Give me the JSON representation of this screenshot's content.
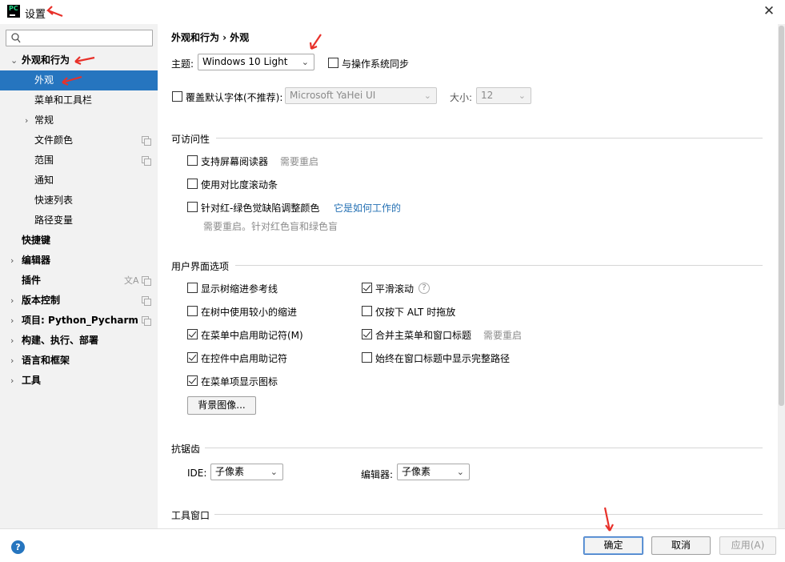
{
  "window": {
    "app_icon_text": "PC",
    "title": "设置",
    "close": "✕"
  },
  "sidebar": {
    "search_placeholder": "",
    "items": [
      {
        "label": "外观和行为",
        "expanded": true,
        "arrow": "⌄"
      },
      {
        "label": "外观",
        "selected": true
      },
      {
        "label": "菜单和工具栏"
      },
      {
        "label": "常规",
        "arrow": "›"
      },
      {
        "label": "文件颜色"
      },
      {
        "label": "范围"
      },
      {
        "label": "通知"
      },
      {
        "label": "快速列表"
      },
      {
        "label": "路径变量"
      },
      {
        "label": "快捷键"
      },
      {
        "label": "编辑器",
        "arrow": "›"
      },
      {
        "label": "插件",
        "lang_icon": "文A"
      },
      {
        "label": "版本控制",
        "arrow": "›"
      },
      {
        "label": "项目: Python_Pycharm",
        "arrow": "›"
      },
      {
        "label": "构建、执行、部署",
        "arrow": "›"
      },
      {
        "label": "语言和框架",
        "arrow": "›"
      },
      {
        "label": "工具",
        "arrow": "›"
      }
    ]
  },
  "main": {
    "breadcrumb": "外观和行为  ›  外观",
    "theme_label": "主题:",
    "theme_value": "Windows 10 Light",
    "sync_os_label": "与操作系统同步",
    "override_font_label": "覆盖默认字体(不推荐):",
    "font_value": "Microsoft YaHei UI",
    "size_label": "大小:",
    "size_value": "12",
    "accessibility": {
      "title": "可访问性",
      "screen_reader": "支持屏幕阅读器",
      "screen_reader_note": "需要重启",
      "contrast_scrollbars": "使用对比度滚动条",
      "color_deficiency": "针对红-绿色觉缺陷调整颜色",
      "how_it_works": "它是如何工作的",
      "color_note": "需要重启。针对红色盲和绿色盲"
    },
    "ui_options": {
      "title": "用户界面选项",
      "tree_indent_guides": "显示树缩进参考线",
      "smaller_indents": "在树中使用较小的缩进",
      "mnemonics_menu": "在菜单中启用助记符(M)",
      "mnemonics_controls": "在控件中启用助记符",
      "menu_icons": "在菜单项显示图标",
      "smooth_scrolling": "平滑滚动",
      "alt_drag": "仅按下 ALT 时拖放",
      "merge_menu": "合并主菜单和窗口标题",
      "merge_menu_note": "需要重启",
      "full_path": "始终在窗口标题中显示完整路径",
      "background_image": "背景图像..."
    },
    "antialiasing": {
      "title": "抗锯齿",
      "ide_label": "IDE:",
      "ide_value": "子像素",
      "editor_label": "编辑器:",
      "editor_value": "子像素"
    },
    "tool_windows_title": "工具窗口"
  },
  "footer": {
    "help": "?",
    "ok": "确定",
    "cancel": "取消",
    "apply": "应用(A)"
  },
  "colors": {
    "selection": "#2675bf",
    "link": "#2470b3",
    "annotation_arrow": "#e8312a"
  }
}
